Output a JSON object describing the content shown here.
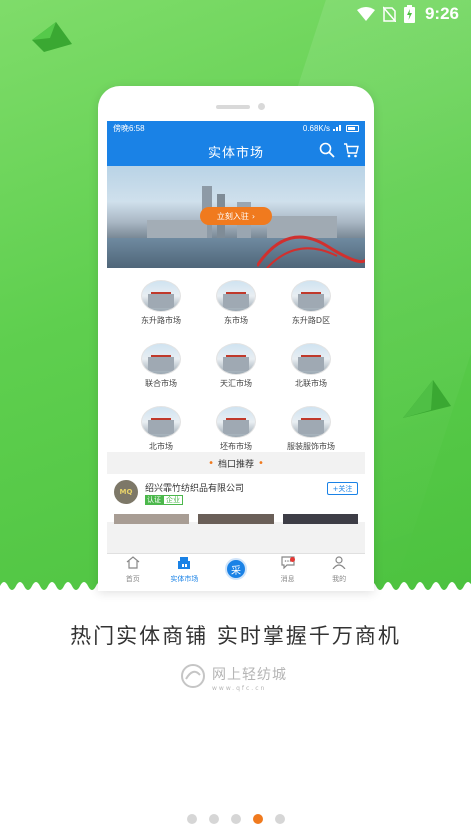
{
  "status_bar": {
    "time": "9:26",
    "icons": [
      "wifi-icon",
      "no-sim-icon",
      "battery-charging-icon"
    ]
  },
  "phone": {
    "inner_status": {
      "left": "傍晚6:58",
      "right": "0.68K/s"
    },
    "header": {
      "title": "实体市场",
      "icons": [
        "search-icon",
        "cart-icon"
      ]
    },
    "banner": {
      "join_label": "立刻入驻"
    },
    "markets": [
      {
        "label": "东升路市场"
      },
      {
        "label": "东市场"
      },
      {
        "label": "东升路D区"
      },
      {
        "label": "联合市场"
      },
      {
        "label": "天汇市场"
      },
      {
        "label": "北联市场"
      },
      {
        "label": "北市场"
      },
      {
        "label": "坯布市场"
      },
      {
        "label": "服装服饰市场"
      }
    ],
    "section_title": "档口推荐",
    "company": {
      "logo_text": "MQ",
      "name": "绍兴霏竹纺织品有限公司",
      "tag_certified": "认证",
      "tag_enterprise": "企业",
      "follow": "+关注"
    },
    "tabs": [
      {
        "label": "首页",
        "icon": "home-icon"
      },
      {
        "label": "实体市场",
        "icon": "market-icon"
      },
      {
        "label": "采",
        "icon": "purchase-icon"
      },
      {
        "label": "消息",
        "icon": "message-icon"
      },
      {
        "label": "我的",
        "icon": "user-icon"
      }
    ]
  },
  "slogan": "热门实体商铺 实时掌握千万商机",
  "brand": {
    "name": "网上轻纺城",
    "url": "www.qfc.cn"
  },
  "pager": {
    "count": 5,
    "active_index": 3
  },
  "colors": {
    "green": "#5fcf4f",
    "app_blue": "#1a82e6",
    "accent_orange": "#f07a1e"
  }
}
